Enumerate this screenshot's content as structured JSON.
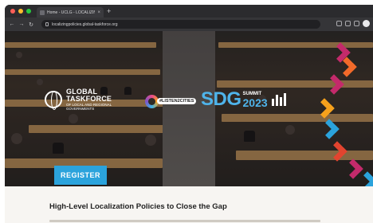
{
  "browser": {
    "tab_title": "Home - UCLG - LOCALIZING T",
    "tab_close": "×",
    "new_tab": "+",
    "url": "localizingpolicies.global-taskforce.org",
    "back": "←",
    "forward": "→",
    "reload": "↻",
    "traffic_lights": [
      "#ff5f57",
      "#febc2e",
      "#28c840"
    ]
  },
  "hero": {
    "gtf": {
      "line1": "GLOBAL",
      "line2": "TASKFORCE",
      "line3": "OF LOCAL AND REGIONAL",
      "line4": "GOVERNMENTS"
    },
    "listen_tag": "#LISTEN2CITIES",
    "sdg": {
      "big": "SDG",
      "summit": "SUMMIT",
      "year": "2023"
    },
    "register_label": "REGISTER",
    "chevron_colors": [
      "#f26a2a",
      "#c42a6b",
      "#f6a11c",
      "#2ba3dc",
      "#e2442f",
      "#c42a6b",
      "#2ba3dc"
    ]
  },
  "content": {
    "heading": "High-Level Localization Policies to Close the Gap"
  }
}
